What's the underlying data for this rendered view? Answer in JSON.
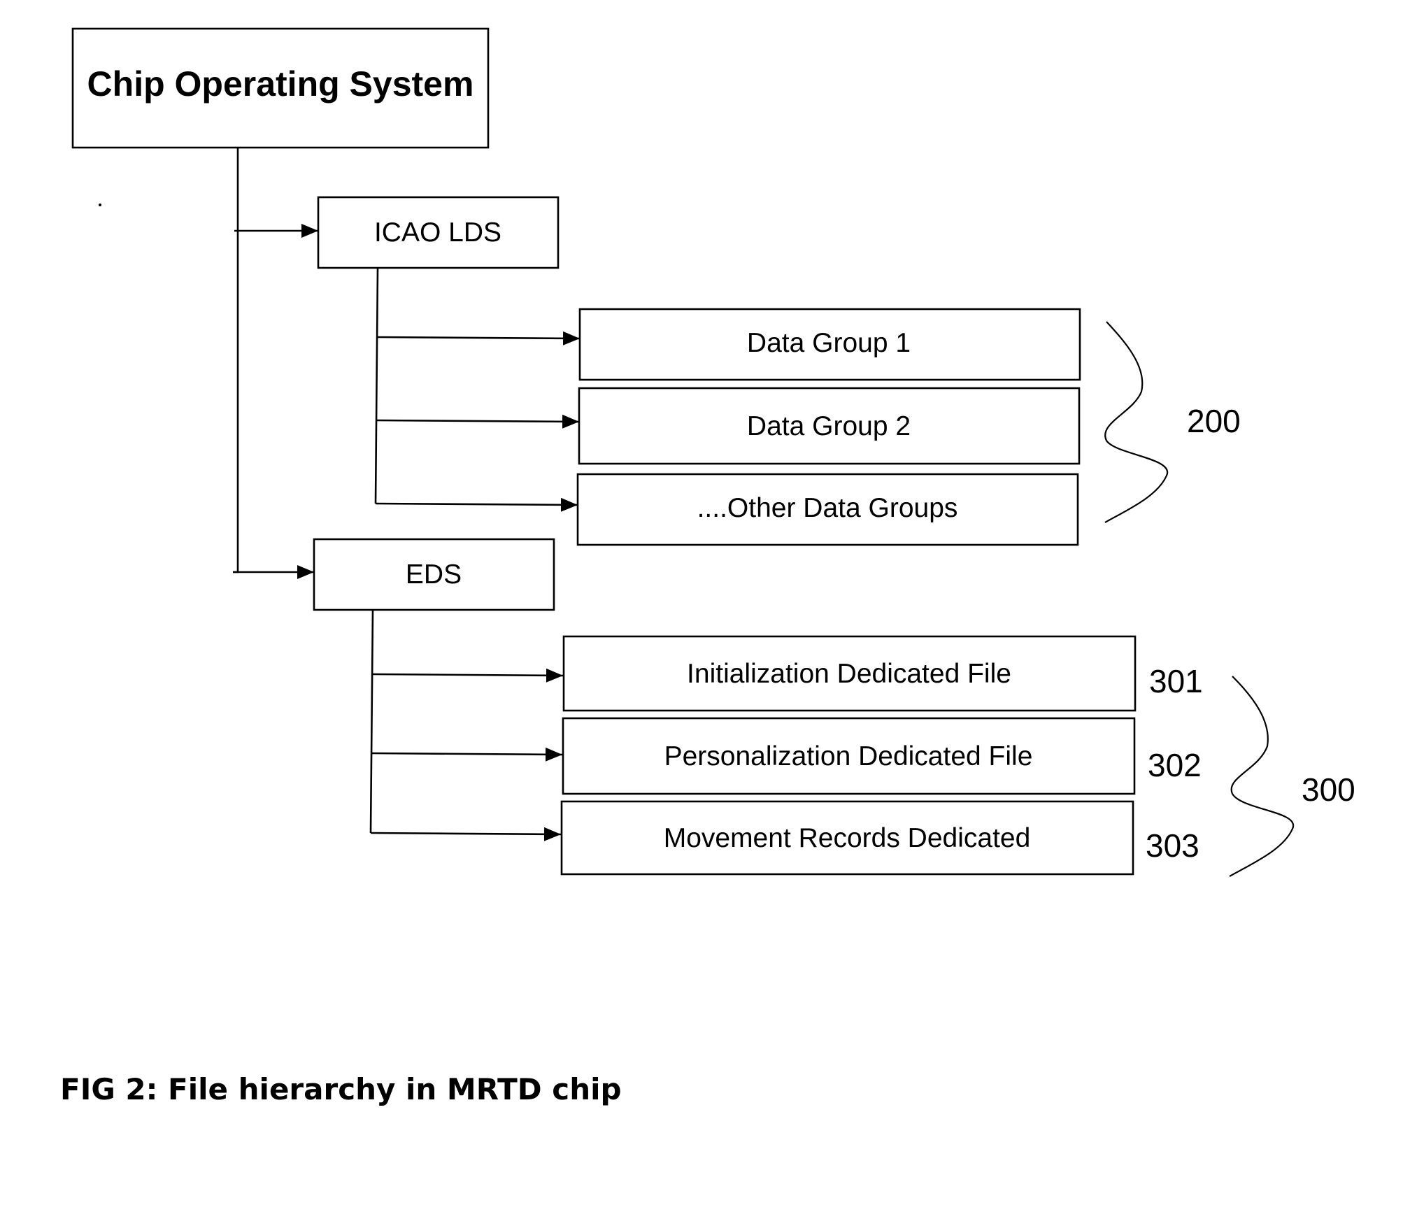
{
  "diagram": {
    "type": "file-hierarchy",
    "root": {
      "label": "Chip Operating System"
    },
    "branches": [
      {
        "label": "ICAO LDS",
        "children": [
          {
            "label": "Data Group 1"
          },
          {
            "label": "Data Group 2"
          },
          {
            "label": "....Other Data Groups"
          }
        ],
        "group_ref": "200"
      },
      {
        "label": "EDS",
        "children": [
          {
            "label": "Initialization Dedicated File",
            "ref": "301"
          },
          {
            "label": "Personalization Dedicated File",
            "ref": "302"
          },
          {
            "label": "Movement Records Dedicated",
            "ref": "303"
          }
        ],
        "group_ref": "300"
      }
    ]
  },
  "caption": "FIG 2: File hierarchy in MRTD chip",
  "colors": {
    "stroke": "#000000",
    "background": "#ffffff",
    "text": "#000000"
  }
}
